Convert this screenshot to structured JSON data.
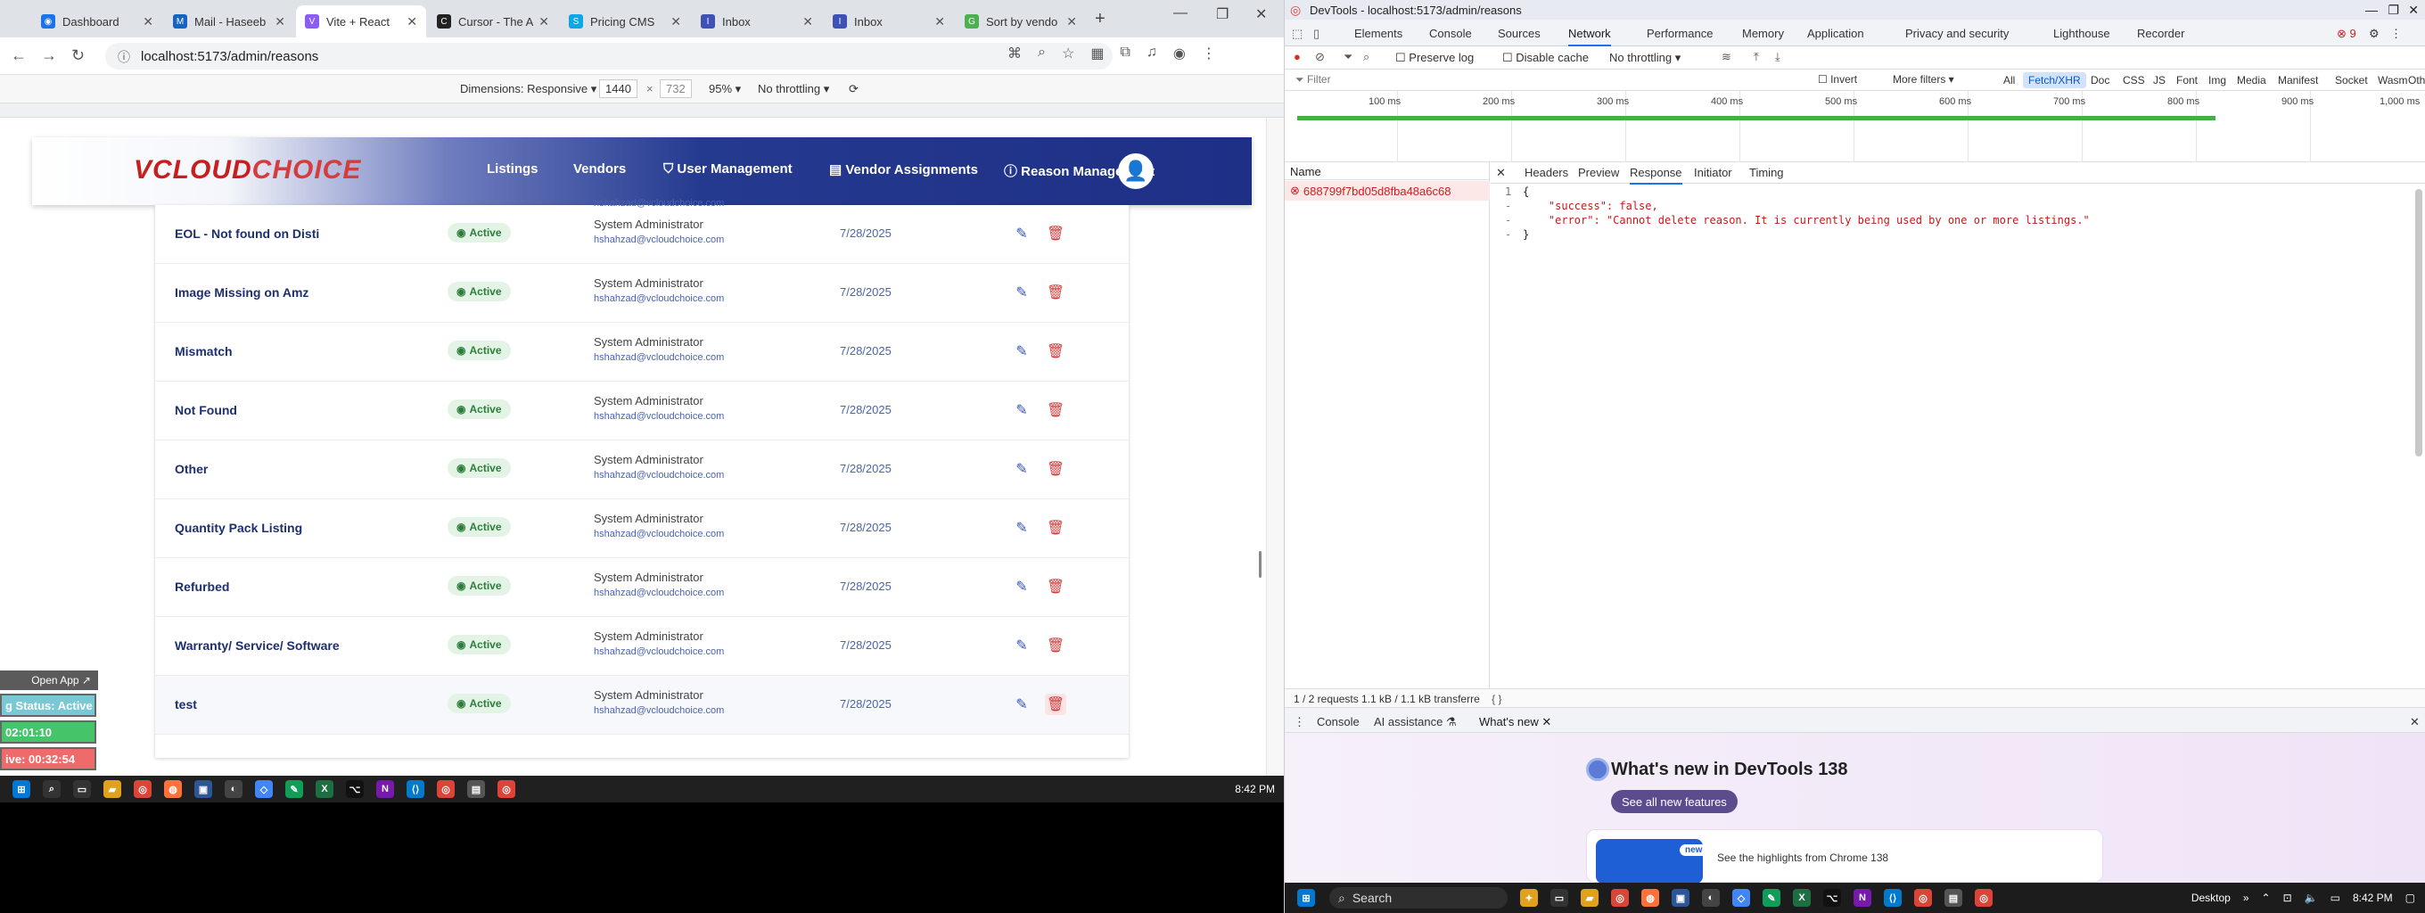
{
  "browser": {
    "tabs": [
      {
        "title": "Dashboard",
        "color": "#1a73e8",
        "glyph": "◉"
      },
      {
        "title": "Mail - Haseeb",
        "color": "#1565c0",
        "glyph": "M"
      },
      {
        "title": "Vite + React",
        "color": "#8b5cf6",
        "glyph": "V"
      },
      {
        "title": "Cursor - The A",
        "color": "#222222",
        "glyph": "C"
      },
      {
        "title": "Pricing CMS",
        "color": "#0ea5e9",
        "glyph": "S"
      },
      {
        "title": "Inbox",
        "color": "#3f51b5",
        "glyph": "I"
      },
      {
        "title": "Inbox",
        "color": "#3f51b5",
        "glyph": "I"
      },
      {
        "title": "Sort by vendo",
        "color": "#4caf50",
        "glyph": "G"
      }
    ],
    "url": "localhost:5173/admin/reasons"
  },
  "device_toolbar": {
    "dimensions_label": "Dimensions: Responsive",
    "width": "1440",
    "height": "732",
    "zoom": "95%",
    "throttling": "No throttling"
  },
  "app": {
    "logo_v": "V",
    "logo_cloud": "CLOUD",
    "logo_choice": "CHOICE",
    "nav": {
      "listings": "Listings",
      "vendors": "Vendors",
      "user_management": "User Management",
      "vendor_assignments": "Vendor Assignments",
      "reason_management": "Reason Management"
    },
    "rows": [
      {
        "name": "EOL - Not found on Disti",
        "status": "Active",
        "user": "System Administrator",
        "email": "hshahzad@vcloudchoice.com",
        "date": "7/28/2025"
      },
      {
        "name": "Image Missing on Amz",
        "status": "Active",
        "user": "System Administrator",
        "email": "hshahzad@vcloudchoice.com",
        "date": "7/28/2025"
      },
      {
        "name": "Mismatch",
        "status": "Active",
        "user": "System Administrator",
        "email": "hshahzad@vcloudchoice.com",
        "date": "7/28/2025"
      },
      {
        "name": "Not Found",
        "status": "Active",
        "user": "System Administrator",
        "email": "hshahzad@vcloudchoice.com",
        "date": "7/28/2025"
      },
      {
        "name": "Other",
        "status": "Active",
        "user": "System Administrator",
        "email": "hshahzad@vcloudchoice.com",
        "date": "7/28/2025"
      },
      {
        "name": "Quantity Pack Listing",
        "status": "Active",
        "user": "System Administrator",
        "email": "hshahzad@vcloudchoice.com",
        "date": "7/28/2025"
      },
      {
        "name": "Refurbed",
        "status": "Active",
        "user": "System Administrator",
        "email": "hshahzad@vcloudchoice.com",
        "date": "7/28/2025"
      },
      {
        "name": "Warranty/ Service/ Software",
        "status": "Active",
        "user": "System Administrator",
        "email": "hshahzad@vcloudchoice.com",
        "date": "7/28/2025"
      },
      {
        "name": "test",
        "status": "Active",
        "user": "System Administrator",
        "email": "hshahzad@vcloudchoice.com",
        "date": "7/28/2025"
      }
    ],
    "clipped_email": "hshahzad@vcloudchoice.com"
  },
  "overlay": {
    "open_app": "Open App ↗",
    "status": "g Status: Active",
    "time": "02:01:10",
    "live": "ive: 00:32:54"
  },
  "taskbar_left": {
    "time": "8:42 PM"
  },
  "devtools": {
    "title": "DevTools - localhost:5173/admin/reasons",
    "tabs": [
      "Elements",
      "Console",
      "Sources",
      "Network",
      "Performance",
      "Memory",
      "Application",
      "Privacy and security",
      "Lighthouse",
      "Recorder"
    ],
    "active_tab": "Network",
    "error_count": "9",
    "preserve_log": "Preserve log",
    "disable_cache": "Disable cache",
    "throttling": "No throttling",
    "filter_placeholder": "Filter",
    "invert": "Invert",
    "more_filters": "More filters",
    "type_filters": [
      "All",
      "Fetch/XHR",
      "Doc",
      "CSS",
      "JS",
      "Font",
      "Img",
      "Media",
      "Manifest",
      "Socket",
      "Wasm",
      "Other"
    ],
    "active_filter": "Fetch/XHR",
    "timeline_ticks": [
      "100 ms",
      "200 ms",
      "300 ms",
      "400 ms",
      "500 ms",
      "600 ms",
      "700 ms",
      "800 ms",
      "900 ms",
      "1,000 ms"
    ],
    "name_header": "Name",
    "request_name": "688799f7bd05d8fba48a6c68",
    "panel_tabs": [
      "Headers",
      "Preview",
      "Response",
      "Initiator",
      "Timing"
    ],
    "active_panel_tab": "Response",
    "response_lines": [
      "{",
      "    \"success\": false,",
      "    \"error\": \"Cannot delete reason. It is currently being used by one or more listings.\"",
      "}"
    ],
    "line_numbers": [
      "1",
      "-",
      "-",
      "-"
    ],
    "status_text": "1 / 2 requests    1.1 kB / 1.1 kB transferre",
    "drawer_tabs": [
      "Console",
      "AI assistance",
      "What's new"
    ],
    "whats_new_title": "What's new in DevTools 138",
    "see_features": "See all new features",
    "card_badge": "new",
    "card_text": "See the highlights from Chrome 138"
  },
  "taskbar_right": {
    "search": "Search",
    "desktop": "Desktop",
    "time": "8:42 PM"
  }
}
